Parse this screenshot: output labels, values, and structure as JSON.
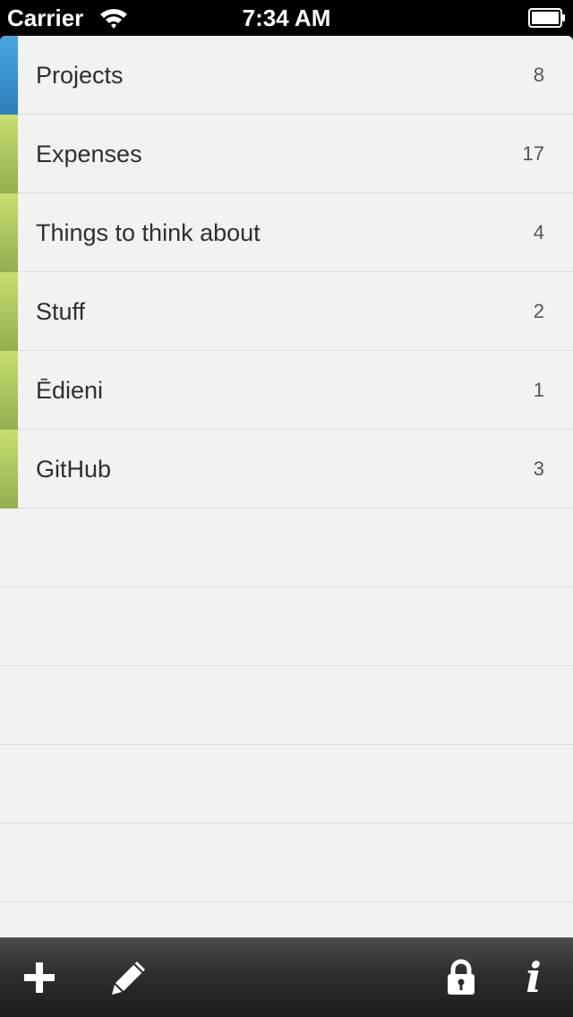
{
  "status_bar": {
    "carrier": "Carrier",
    "time": "7:34 AM"
  },
  "lists": [
    {
      "title": "Projects",
      "count": "8",
      "color": "#3a93d0"
    },
    {
      "title": "Expenses",
      "count": "17",
      "color": "#adc75e"
    },
    {
      "title": "Things to think about",
      "count": "4",
      "color": "#adc75e"
    },
    {
      "title": "Stuff",
      "count": "2",
      "color": "#adc75e"
    },
    {
      "title": "Ēdieni",
      "count": "1",
      "color": "#adc75e"
    },
    {
      "title": "GitHub",
      "count": "3",
      "color": "#adc75e"
    }
  ],
  "toolbar": {
    "add_icon": "plus-icon",
    "edit_icon": "pencil-icon",
    "lock_icon": "lock-icon",
    "info_icon": "info-icon",
    "info_glyph": "i"
  }
}
